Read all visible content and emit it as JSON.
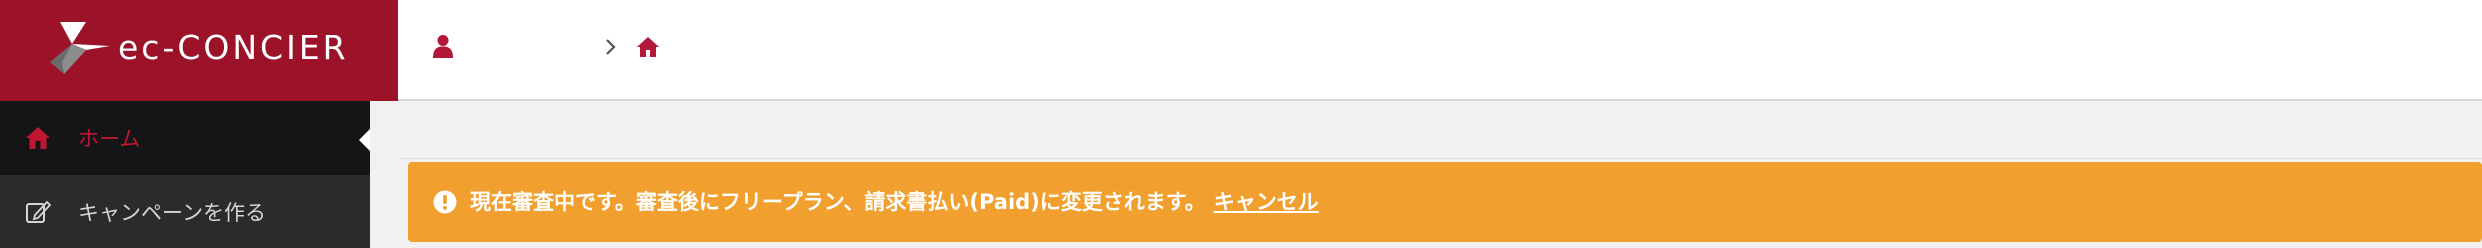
{
  "header": {
    "logo_text": "ec-CONCIER",
    "brand_color": "#9c1229",
    "breadcrumb": {
      "user_icon": "user-icon",
      "separator_icon": "chevron-right-icon",
      "home_icon": "home-icon"
    }
  },
  "sidebar": {
    "items": [
      {
        "label": "ホーム",
        "icon": "home-icon",
        "active": true
      },
      {
        "label": "キャンペーンを作る",
        "icon": "edit-icon",
        "active": false
      }
    ]
  },
  "alert": {
    "icon": "exclamation-circle-icon",
    "message": "現在審査中です。審査後にフリープラン、請求書払い(Paid)に変更されます。",
    "cancel_label": "キャンセル",
    "color": "#f19f2e"
  }
}
